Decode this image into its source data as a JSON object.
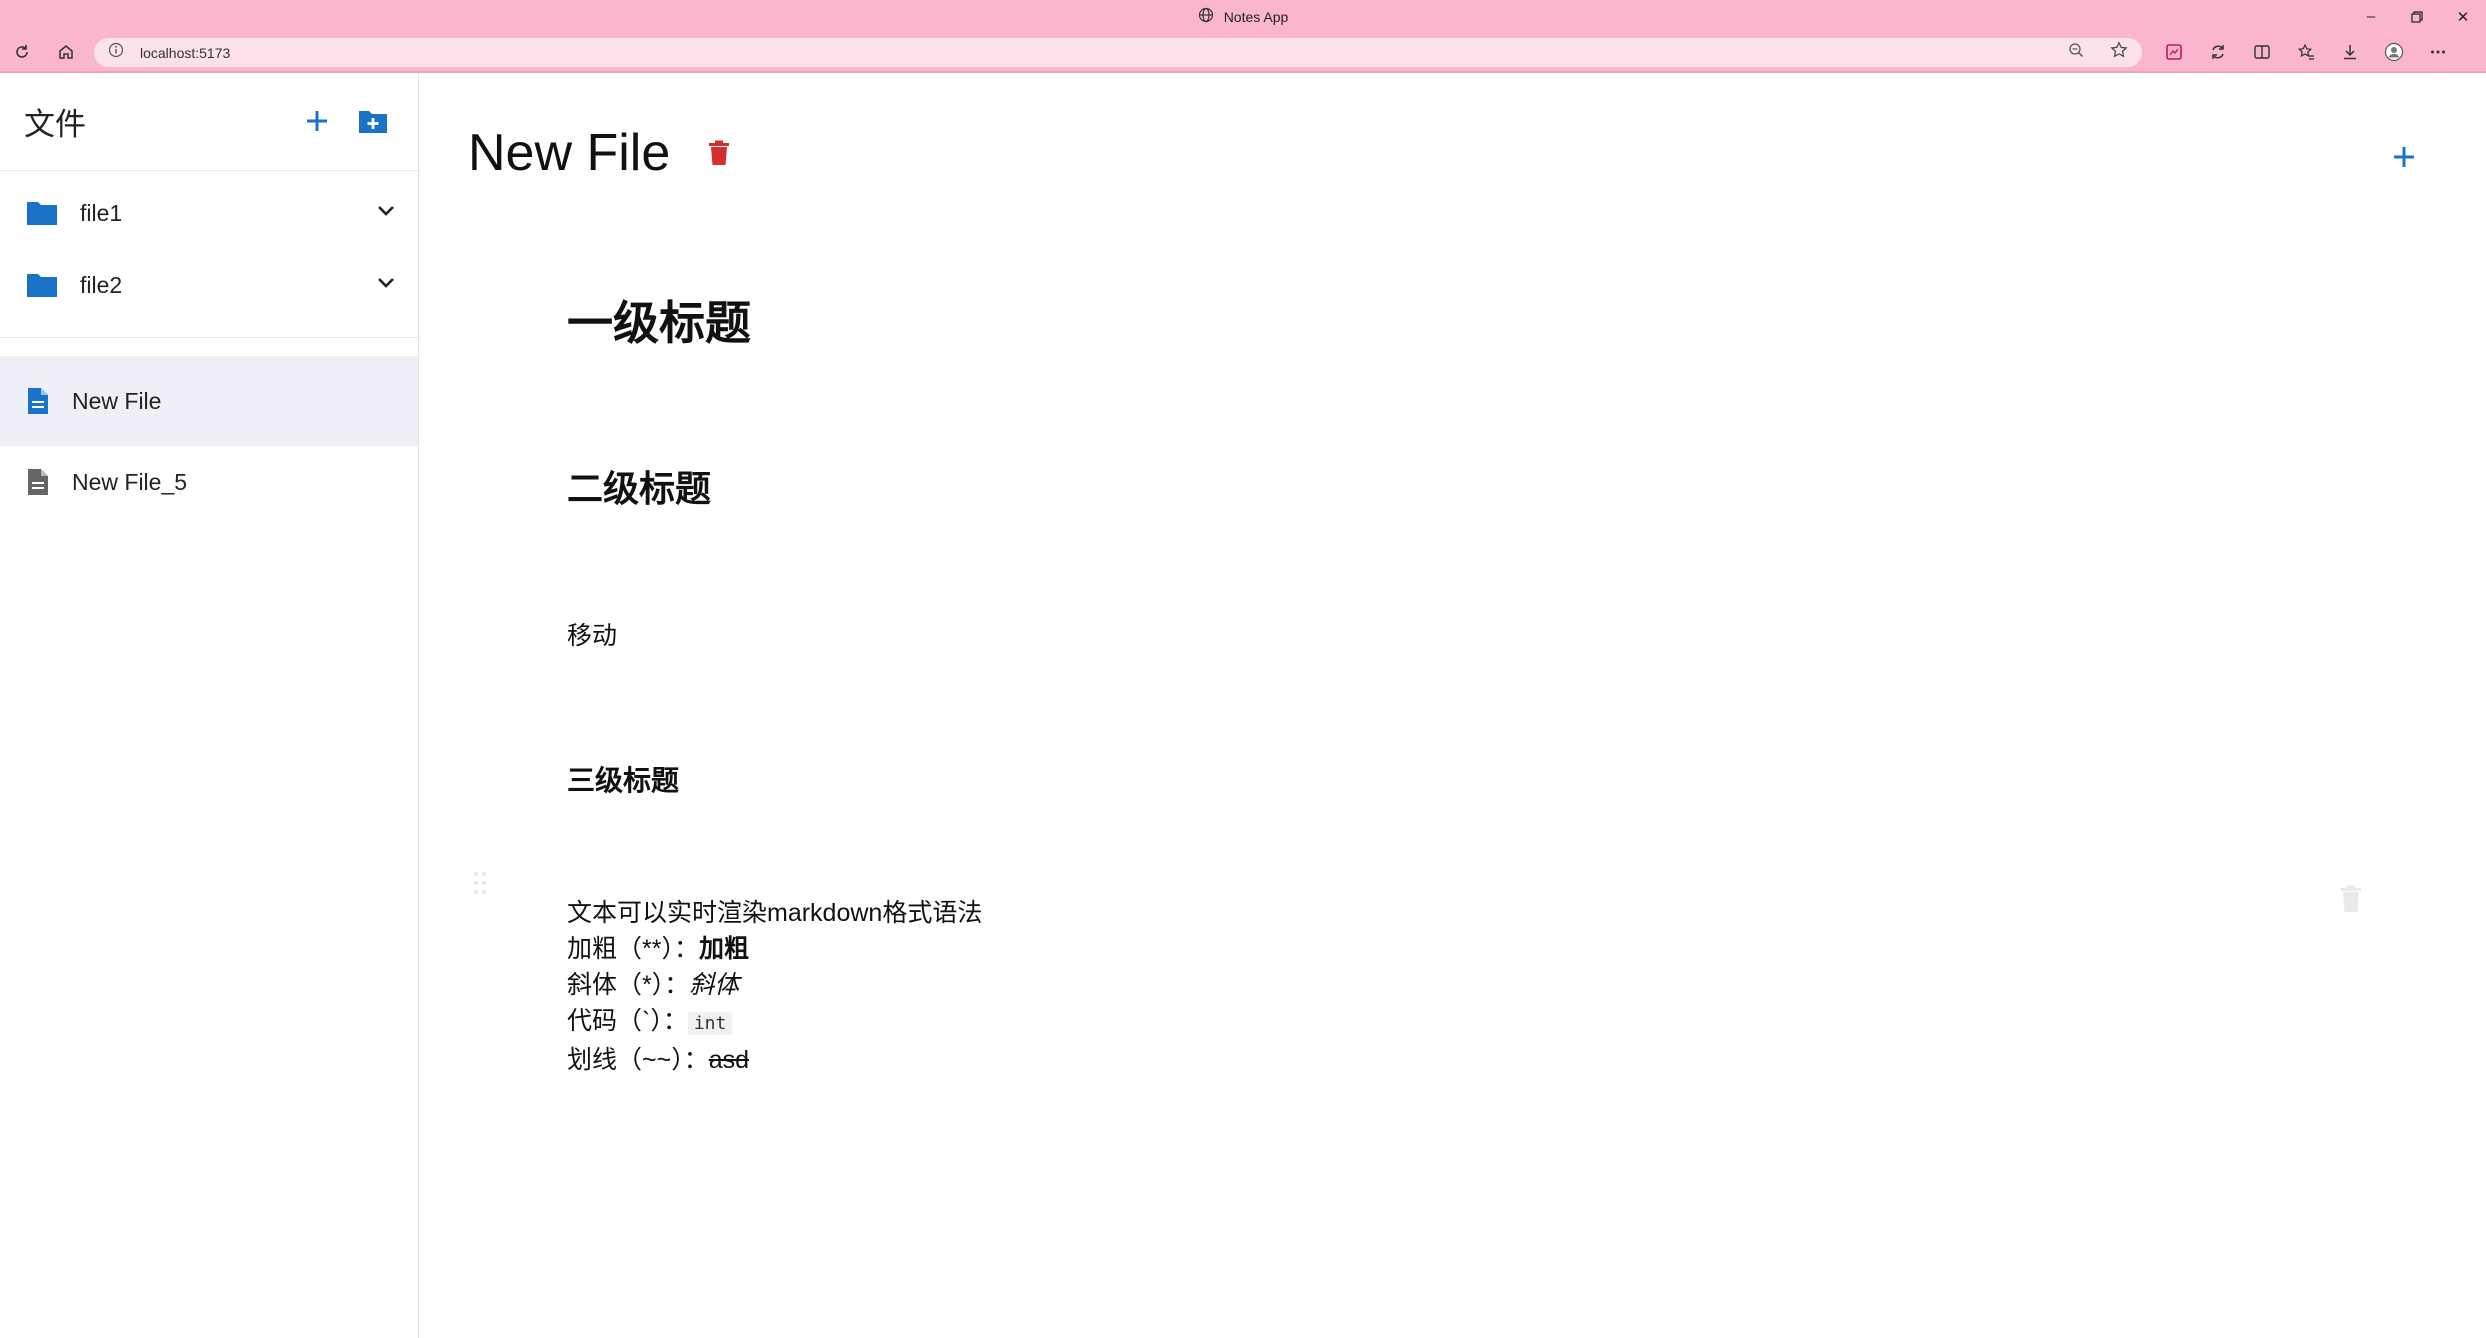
{
  "browser": {
    "window_title": "Notes App",
    "url": "localhost:5173",
    "window_controls": [
      "minimize-icon",
      "restore-icon",
      "close-icon"
    ],
    "toolbar_icons": [
      "reload-icon",
      "home-icon"
    ],
    "address_icons": [
      "info-icon",
      "zoom-icon",
      "star-icon"
    ],
    "extension_icons": [
      "extension-icon",
      "sync-icon",
      "split-screen-icon",
      "favorites-icon",
      "download-icon",
      "profile-icon",
      "more-icon"
    ],
    "chrome_color": "#fbb6cf"
  },
  "sidebar": {
    "title": "文件",
    "add_file_icon": "plus-icon",
    "add_folder_icon": "folder-plus-icon",
    "folders": [
      {
        "label": "file1",
        "icon": "folder-icon"
      },
      {
        "label": "file2",
        "icon": "folder-icon"
      }
    ],
    "files": [
      {
        "label": "New File",
        "icon": "document-icon",
        "selected": true
      },
      {
        "label": "New File_5",
        "icon": "document-icon",
        "selected": false
      }
    ],
    "accent": "#1a73c8"
  },
  "document": {
    "title": "New File",
    "delete_icon": "trash-icon",
    "delete_color": "#d32f2f",
    "add_icon": "plus-icon",
    "blocks": {
      "h1": "一级标题",
      "h2": "二级标题",
      "paragraph": "移动",
      "h3": "三级标题",
      "md_intro": "文本可以实时渲染markdown格式语法",
      "bold_label": "加粗（**）：",
      "bold_value": "加粗",
      "italic_label": "斜体（*）：",
      "italic_value": "斜体",
      "code_label": "代码（`）：",
      "code_value": "int",
      "strike_label": "划线（~~）：",
      "strike_value": "asd"
    }
  }
}
